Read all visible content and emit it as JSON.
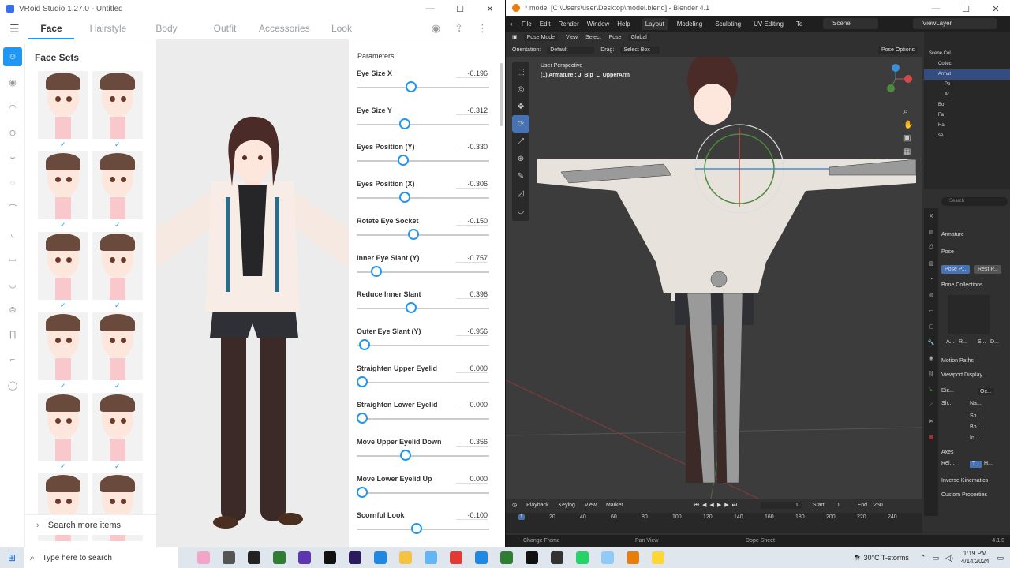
{
  "vroid": {
    "title": "VRoid Studio 1.27.0 - Untitled",
    "tabs": [
      {
        "label": "Face",
        "active": true
      },
      {
        "label": "Hairstyle",
        "active": false
      },
      {
        "label": "Body",
        "active": false
      },
      {
        "label": "Outfit",
        "active": false
      },
      {
        "label": "Accessories",
        "active": false
      },
      {
        "label": "Look",
        "active": false
      }
    ],
    "tool_icons": [
      "camera-icon",
      "share-icon",
      "more-vert-icon"
    ],
    "rail_icons": [
      "face-set-icon",
      "eye-icon",
      "eyebrow-icon",
      "eyelid-icon",
      "eye-lash-icon",
      "ear-icon",
      "nose-icon",
      "mouth-icon",
      "teeth-icon",
      "face-contour-icon",
      "head-icon",
      "neck-icon",
      "neck-2-icon",
      "extra-icon"
    ],
    "face_sets_title": "Face Sets",
    "check": "✓",
    "search_more_label": "Search more items",
    "parameters_title": "Parameters",
    "params": [
      {
        "label": "Eye Size X",
        "value": "-0.196",
        "level": 0.4
      },
      {
        "label": "Eye Size Y",
        "value": "-0.312",
        "level": 0.35
      },
      {
        "label": "Eyes Position (Y)",
        "value": "-0.330",
        "level": 0.34
      },
      {
        "label": "Eyes Position (X)",
        "value": "-0.306",
        "level": 0.35
      },
      {
        "label": "Rotate Eye Socket",
        "value": "-0.150",
        "level": 0.42
      },
      {
        "label": "Inner Eye Slant (Y)",
        "value": "-0.757",
        "level": 0.12
      },
      {
        "label": "Reduce Inner Slant",
        "value": "0.396",
        "level": 0.4
      },
      {
        "label": "Outer Eye Slant (Y)",
        "value": "-0.956",
        "level": 0.02
      },
      {
        "label": "Straighten Upper Eyelid",
        "value": "0.000",
        "level": 0.0
      },
      {
        "label": "Straighten Lower Eyelid",
        "value": "0.000",
        "level": 0.0
      },
      {
        "label": "Move Upper Eyelid Down",
        "value": "0.356",
        "level": 0.36
      },
      {
        "label": "Move Lower Eyelid Up",
        "value": "0.000",
        "level": 0.0
      },
      {
        "label": "Scornful Look",
        "value": "-0.100",
        "level": 0.45
      }
    ]
  },
  "blender": {
    "title": "* model [C:\\Users\\user\\Desktop\\model.blend] - Blender 4.1",
    "menus": [
      "File",
      "Edit",
      "Render",
      "Window",
      "Help"
    ],
    "workspaces": [
      {
        "label": "Layout",
        "active": true
      },
      {
        "label": "Modeling",
        "active": false
      },
      {
        "label": "Sculpting",
        "active": false
      },
      {
        "label": "UV Editing",
        "active": false
      },
      {
        "label": "Te",
        "active": false
      }
    ],
    "scene_label": "Scene",
    "viewlayer_label": "ViewLayer",
    "mode_label": "Pose Mode",
    "header_menus": [
      "View",
      "Select",
      "Pose"
    ],
    "transform_label": "Global",
    "orientation_label": "Orientation:",
    "orientation_value": "Default",
    "drag_label": "Drag:",
    "drag_value": "Select Box",
    "pose_options_label": "Pose Options",
    "viewport_line1": "User Perspective",
    "viewport_line2": "(1) Armature : J_Bip_L_UpperArm",
    "outliner_items": [
      "Scene Col",
      "Collec",
      "Armat",
      "Po",
      "Ar",
      "Bo",
      "Fa",
      "Ha",
      "se"
    ],
    "props": {
      "search_placeholder": "Search",
      "object_name": "Armature",
      "pose_section": "Pose",
      "pose_position": "Pose P...",
      "rest_position": "Rest P...",
      "bone_collections": "Bone Collections",
      "motion_paths": "Motion Paths",
      "viewport_display": "Viewport Display",
      "display_as_label": "Dis...",
      "display_as_value": "Oc...",
      "show_label": "Sh...",
      "names": "Na...",
      "shapes": "Sh...",
      "bone_colors": "Bo...",
      "in_front": "In ...",
      "axes_label": "Axes",
      "relation_label": "Rel...",
      "relation_opt1": "T...",
      "relation_opt2": "H...",
      "inverse_kinematics": "Inverse Kinematics",
      "custom_properties": "Custom Properties",
      "ar_btn": "A...",
      "r_btn": "R...",
      "s_btn": "S...",
      "d_btn": "D..."
    },
    "timeline": {
      "menus": [
        "Playback",
        "Keying",
        "View",
        "Marker"
      ],
      "current_frame": "1",
      "start_label": "Start",
      "start_value": "1",
      "end_label": "End",
      "end_value": "250",
      "ticks": [
        "1",
        "20",
        "40",
        "60",
        "80",
        "100",
        "120",
        "140",
        "160",
        "180",
        "200",
        "220",
        "240"
      ]
    },
    "status": {
      "left": "Change Frame",
      "mid": "Pan View",
      "right": "Dope Sheet",
      "version": "4.1.0"
    }
  },
  "taskbar": {
    "search_placeholder": "Type here to search",
    "weather": "30°C  T-storms",
    "time": "1:19 PM",
    "date": "4/14/2024"
  }
}
